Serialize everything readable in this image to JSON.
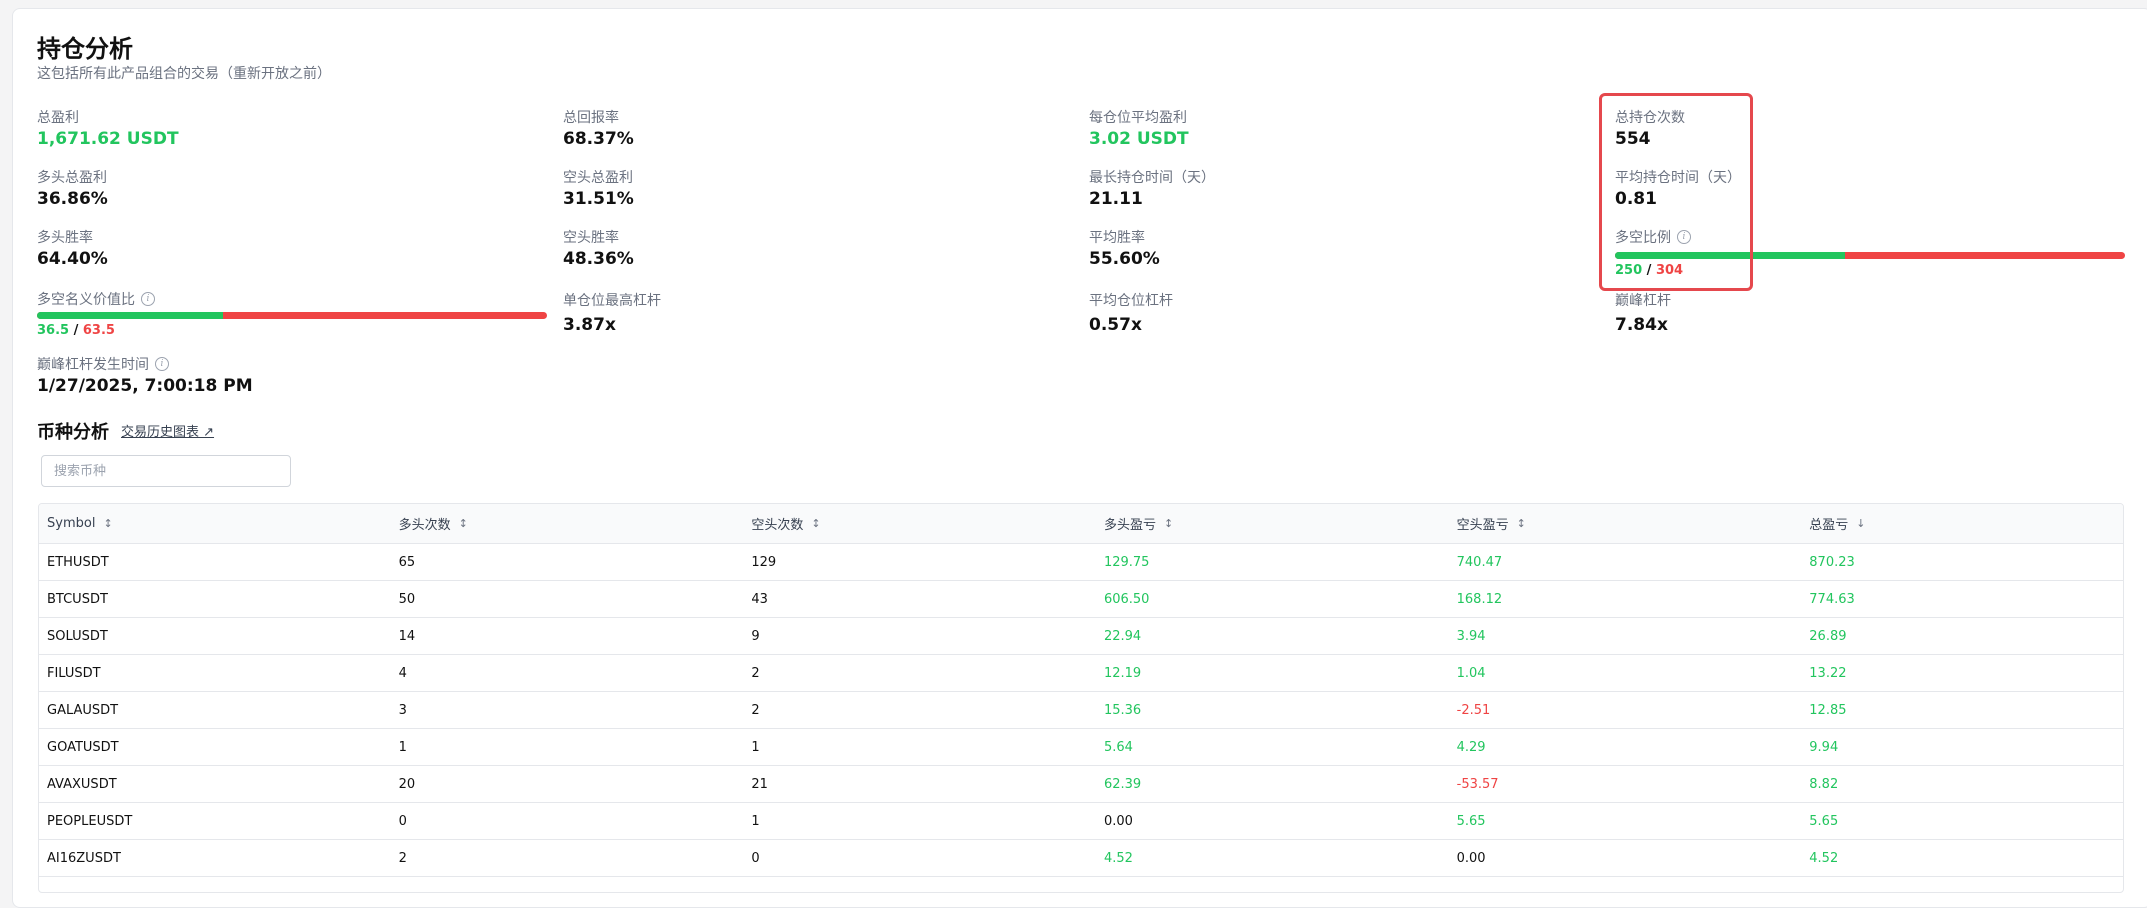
{
  "header": {
    "title": "持仓分析",
    "subtitle": "这包括所有此产品组合的交易（重新开放之前）"
  },
  "stats": {
    "total_pnl": {
      "label": "总盈利",
      "value": "1,671.62 USDT"
    },
    "total_return": {
      "label": "总回报率",
      "value": "68.37%"
    },
    "avg_pnl_per_position": {
      "label": "每仓位平均盈利",
      "value": "3.02 USDT"
    },
    "total_positions": {
      "label": "总持仓次数",
      "value": "554"
    },
    "long_total_pnl": {
      "label": "多头总盈利",
      "value": "36.86%"
    },
    "short_total_pnl": {
      "label": "空头总盈利",
      "value": "31.51%"
    },
    "longest_hold": {
      "label": "最长持仓时间（天）",
      "value": "21.11"
    },
    "avg_hold": {
      "label": "平均持仓时间（天）",
      "value": "0.81"
    },
    "long_win_rate": {
      "label": "多头胜率",
      "value": "64.40%"
    },
    "short_win_rate": {
      "label": "空头胜率",
      "value": "48.36%"
    },
    "avg_win_rate": {
      "label": "平均胜率",
      "value": "55.60%"
    },
    "long_short_ratio": {
      "label": "多空比例",
      "long": "250",
      "short": "304",
      "sep": "/",
      "long_fraction": 0.4513
    },
    "notional_ratio": {
      "label": "多空名义价值比",
      "long": "36.5",
      "short": "63.5",
      "sep": "/",
      "long_fraction": 0.365
    },
    "max_leverage_single": {
      "label": "单仓位最高杠杆",
      "value": "3.87x"
    },
    "avg_leverage": {
      "label": "平均仓位杠杆",
      "value": "0.57x"
    },
    "peak_leverage": {
      "label": "巅峰杠杆",
      "value": "7.84x"
    },
    "peak_leverage_time": {
      "label": "巅峰杠杆发生时间",
      "value": "1/27/2025, 7:00:18 PM"
    }
  },
  "coin_section": {
    "title": "币种分析",
    "history_link": "交易历史图表 ↗",
    "search_placeholder": "搜索币种"
  },
  "table": {
    "columns": [
      {
        "label": "Symbol",
        "sort": "↕"
      },
      {
        "label": "多头次数",
        "sort": "↕"
      },
      {
        "label": "空头次数",
        "sort": "↕"
      },
      {
        "label": "多头盈亏",
        "sort": "↕"
      },
      {
        "label": "空头盈亏",
        "sort": "↕"
      },
      {
        "label": "总盈亏",
        "sort": "↓"
      }
    ],
    "rows": [
      [
        "ETHUSDT",
        "65",
        "129",
        "129.75",
        "740.47",
        "870.23"
      ],
      [
        "BTCUSDT",
        "50",
        "43",
        "606.50",
        "168.12",
        "774.63"
      ],
      [
        "SOLUSDT",
        "14",
        "9",
        "22.94",
        "3.94",
        "26.89"
      ],
      [
        "FILUSDT",
        "4",
        "2",
        "12.19",
        "1.04",
        "13.22"
      ],
      [
        "GALAUSDT",
        "3",
        "2",
        "15.36",
        "-2.51",
        "12.85"
      ],
      [
        "GOATUSDT",
        "1",
        "1",
        "5.64",
        "4.29",
        "9.94"
      ],
      [
        "AVAXUSDT",
        "20",
        "21",
        "62.39",
        "-53.57",
        "8.82"
      ],
      [
        "PEOPLEUSDT",
        "0",
        "1",
        "0.00",
        "5.65",
        "5.65"
      ],
      [
        "AI16ZUSDT",
        "2",
        "0",
        "4.52",
        "0.00",
        "4.52"
      ]
    ]
  },
  "colors": {
    "positive": "#22c55e",
    "negative": "#ef4444",
    "highlight": "#e5484d"
  }
}
